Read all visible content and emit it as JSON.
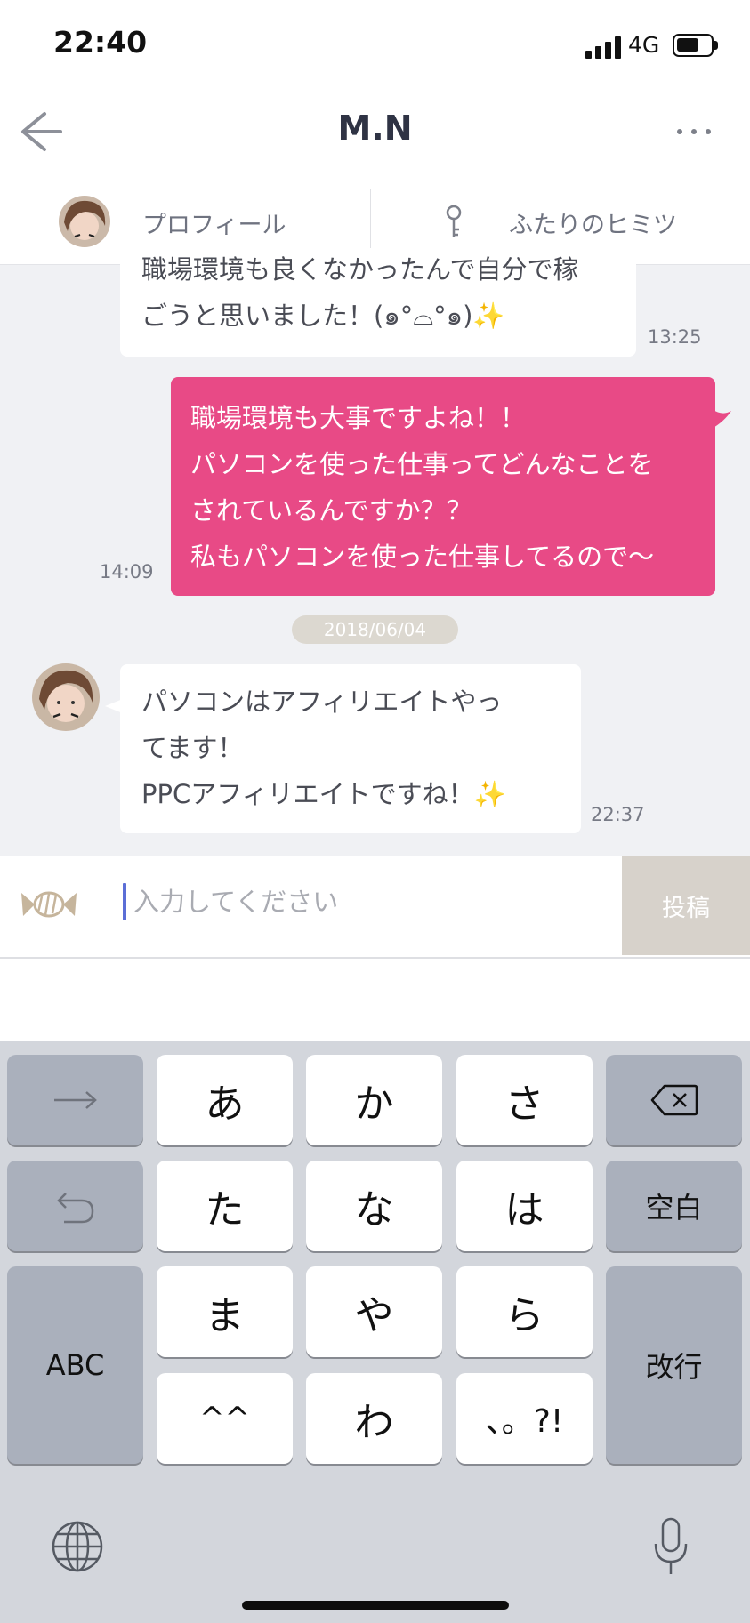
{
  "status_bar": {
    "time": "22:40",
    "network": "4G"
  },
  "nav": {
    "title": "M.N"
  },
  "tabs": {
    "profile": "プロフィール",
    "secret": "ふたりのヒミツ"
  },
  "messages": [
    {
      "side": "in",
      "lines": [
        "職場環境も良くなかったんで自分で稼",
        "ごうと思いました！(๑°⌓°๑)✨"
      ],
      "time": "13:25"
    },
    {
      "side": "out",
      "lines": [
        "職場環境も大事ですよね！！",
        "パソコンを使った仕事ってどんなことを",
        "されているんですか？？",
        "私もパソコンを使った仕事してるので〜"
      ],
      "time": "14:09"
    },
    {
      "side": "in",
      "lines": [
        "パソコンはアフィリエイトやっ",
        "てます！",
        "PPCアフィリエイトですね！✨"
      ],
      "time": "22:37"
    }
  ],
  "date_separator": "2018/06/04",
  "composer": {
    "placeholder": "入力してください",
    "value": "",
    "post_label": "投稿"
  },
  "keyboard": {
    "row1": [
      "→",
      "あ",
      "か",
      "さ",
      "⌫"
    ],
    "row2": [
      "↺",
      "た",
      "な",
      "は",
      "空白"
    ],
    "row3": [
      "ABC",
      "ま",
      "や",
      "ら",
      "改行"
    ],
    "row4": [
      "^^",
      "わ",
      "、。?!"
    ]
  },
  "colors": {
    "accent_pink": "#e84a86",
    "post_button": "#d7d2cb",
    "date_pill": "#dcd8d0",
    "caret": "#5b6ed6"
  },
  "icons": [
    "back-arrow-icon",
    "more-dots-icon",
    "key-icon",
    "candy-icon",
    "globe-icon",
    "microphone-icon"
  ]
}
